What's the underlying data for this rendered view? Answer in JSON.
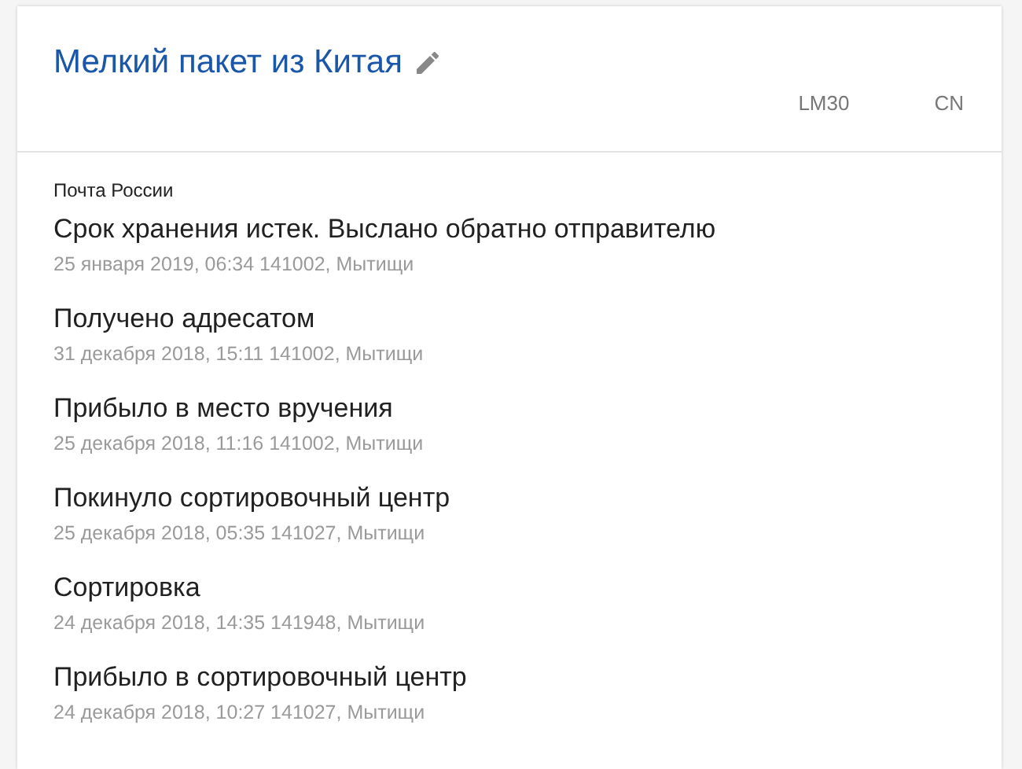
{
  "parcel": {
    "title": "Мелкий пакет из Китая",
    "tracking_parts": [
      "LM30",
      "CN"
    ]
  },
  "carrier": "Почта России",
  "events": [
    {
      "status": "Срок хранения истек. Выслано обратно отправителю",
      "details": "25 января 2019, 06:34 141002, Мытищи"
    },
    {
      "status": "Получено адресатом",
      "details": "31 декабря 2018, 15:11 141002, Мытищи"
    },
    {
      "status": "Прибыло в место вручения",
      "details": "25 декабря 2018, 11:16 141002, Мытищи"
    },
    {
      "status": "Покинуло сортировочный центр",
      "details": "25 декабря 2018, 05:35 141027, Мытищи"
    },
    {
      "status": "Сортировка",
      "details": "24 декабря 2018, 14:35 141948, Мытищи"
    },
    {
      "status": "Прибыло в сортировочный центр",
      "details": "24 декабря 2018, 10:27 141027, Мытищи"
    }
  ]
}
